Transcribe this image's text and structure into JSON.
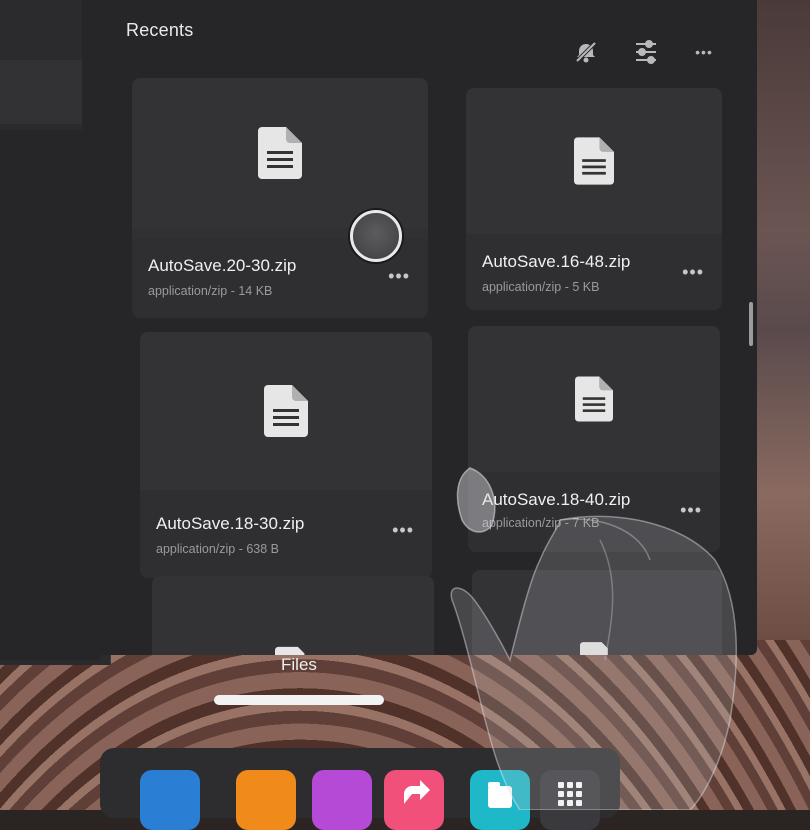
{
  "header": {
    "title": "Recents"
  },
  "toolbar": {
    "icons": [
      "mute-notification-icon",
      "filter-sliders-icon",
      "more-horizontal-icon"
    ],
    "more_label": "•••"
  },
  "files": [
    {
      "name": "AutoSave.20-30.zip",
      "meta": "application/zip - 14 KB"
    },
    {
      "name": "AutoSave.16-48.zip",
      "meta": "application/zip - 5 KB"
    },
    {
      "name": "AutoSave.18-30.zip",
      "meta": "application/zip - 638 B"
    },
    {
      "name": "AutoSave.18-40.zip",
      "meta": "application/zip - 7 KB"
    }
  ],
  "card_more_label": "•••",
  "bottom": {
    "app_label": "Files"
  },
  "dock": {
    "apps": [
      {
        "name": "dock-app-blue",
        "color": "#2a7fd4"
      },
      {
        "name": "dock-app-orange",
        "color": "#f08a1a"
      },
      {
        "name": "dock-app-purple",
        "color": "#b54ad6"
      },
      {
        "name": "dock-app-share",
        "color": "#f0507a"
      },
      {
        "name": "dock-app-files",
        "color": "#1fb8c8"
      },
      {
        "name": "dock-app-grid",
        "color": "#3a3a3e"
      }
    ]
  }
}
